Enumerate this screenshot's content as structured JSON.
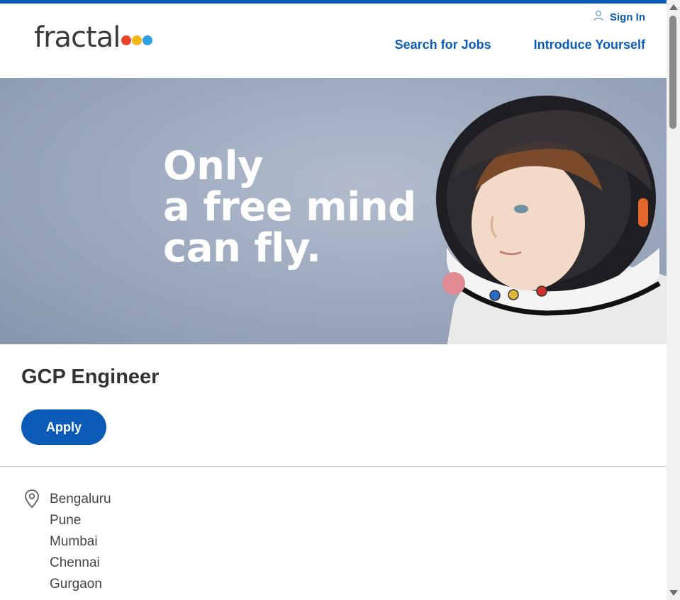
{
  "brand": {
    "logo_text": "fractal",
    "dot_colors": [
      "#e8452c",
      "#f5b81c",
      "#2fa3e0"
    ],
    "accent_color": "#0a5cb8"
  },
  "header": {
    "sign_in_label": "Sign In",
    "sign_in_icon": "user-icon",
    "nav": [
      "Search for Jobs",
      "Introduce Yourself"
    ]
  },
  "hero": {
    "lines": [
      "Only",
      "a free mind",
      "can fly."
    ]
  },
  "job": {
    "title": "GCP Engineer",
    "apply_label": "Apply",
    "location_icon": "location-pin-icon",
    "locations": [
      "Bengaluru",
      "Pune",
      "Mumbai",
      "Chennai",
      "Gurgaon"
    ]
  }
}
